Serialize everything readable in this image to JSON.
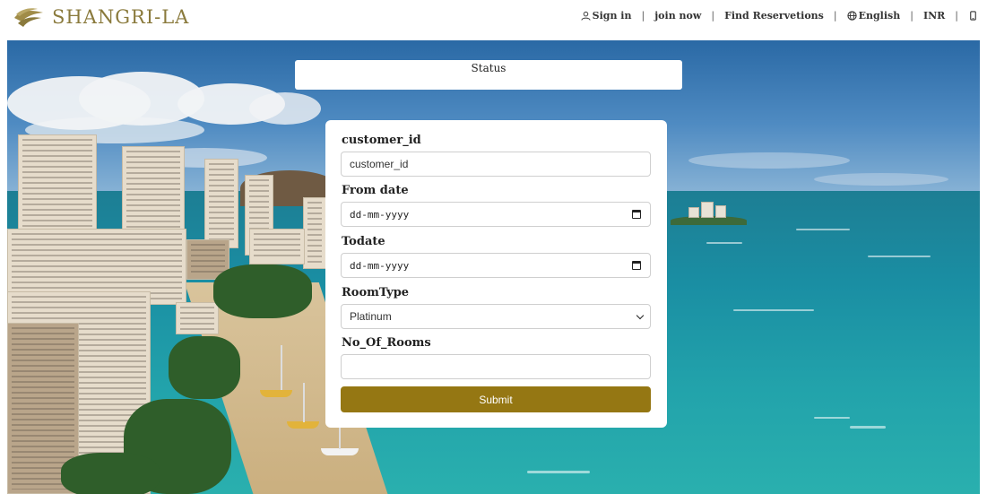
{
  "header": {
    "brand": "SHANGRI-LA",
    "nav": {
      "sign_in": "Sign in",
      "join_now": "join now",
      "find_reservations": "Find Reservetions",
      "language": "English",
      "currency": "INR"
    },
    "separator": "|"
  },
  "status": {
    "label": "Status"
  },
  "form": {
    "customer_id": {
      "label": "customer_id",
      "placeholder": "customer_id"
    },
    "from_date": {
      "label": "From date",
      "value": "dd-mm-yyyy"
    },
    "to_date": {
      "label": "Todate",
      "value": "dd-mm-yyyy"
    },
    "room_type": {
      "label": "RoomType",
      "selected": "Platinum"
    },
    "no_of_rooms": {
      "label": "No_Of_Rooms",
      "value": ""
    },
    "submit_label": "Submit"
  },
  "colors": {
    "brand_gold": "#8a7a3c",
    "submit_bg": "#957713"
  },
  "icons": {
    "brand": "shangri-la-logo-icon",
    "user": "user-icon",
    "globe": "globe-icon",
    "phone": "phone-icon",
    "calendar": "calendar-icon",
    "dropdown": "chevron-down-icon"
  }
}
